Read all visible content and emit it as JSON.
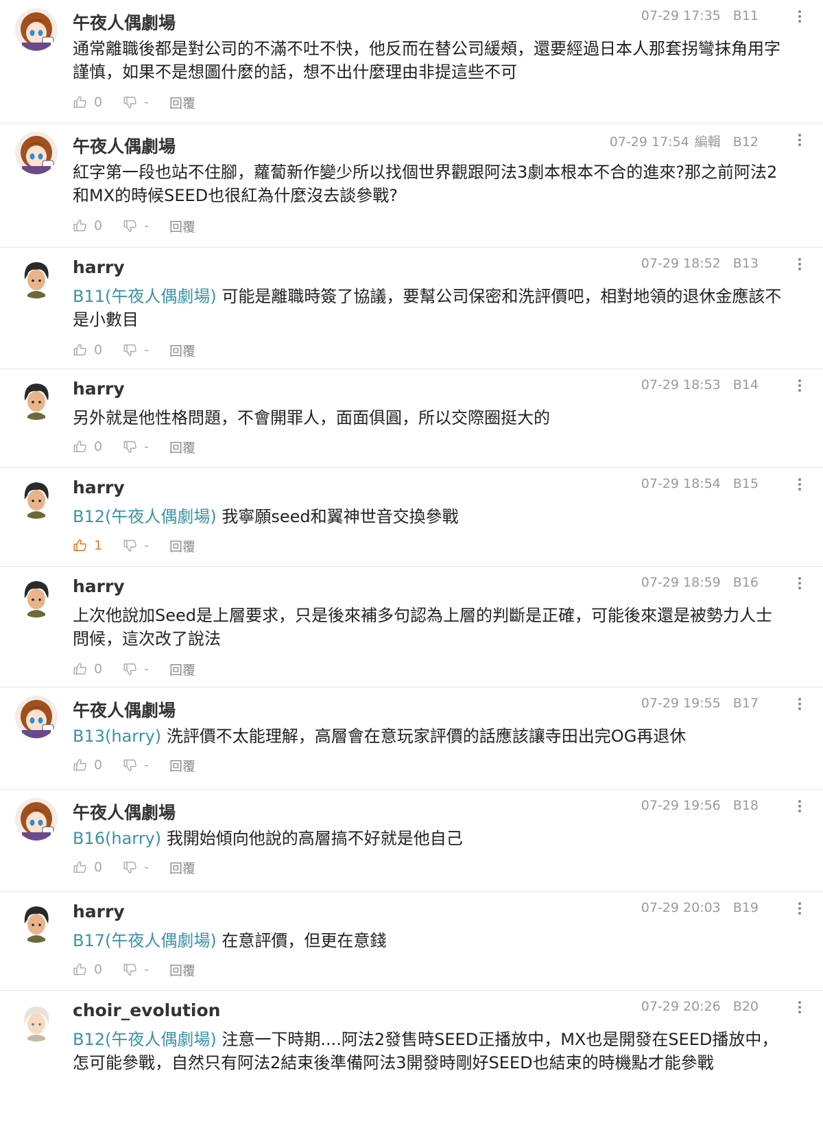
{
  "comments": [
    {
      "author": "午夜人偶劇場",
      "avatar": "anime-girl-avatar",
      "time": "07-29 17:35",
      "edited": "",
      "floor": "B11",
      "mention": "",
      "text": "通常離職後都是對公司的不滿不吐不快，他反而在替公司緩頰，還要經過日本人那套拐彎抹角用字謹慎，如果不是想圖什麼的話，想不出什麼理由非提這些不可",
      "likes": "0",
      "dislikes": "-",
      "reply_label": "回覆",
      "liked": false
    },
    {
      "author": "午夜人偶劇場",
      "avatar": "anime-girl-avatar",
      "time": "07-29 17:54",
      "edited": "編輯",
      "floor": "B12",
      "mention": "",
      "text": "紅字第一段也站不住腳，蘿蔔新作變少所以找個世界觀跟阿法3劇本根本不合的進來?那之前阿法2和MX的時候SEED也很紅為什麼沒去談參戰?",
      "likes": "0",
      "dislikes": "-",
      "reply_label": "回覆",
      "liked": false
    },
    {
      "author": "harry",
      "avatar": "dark-hair-boy-avatar",
      "time": "07-29 18:52",
      "edited": "",
      "floor": "B13",
      "mention": "B11(午夜人偶劇場)",
      "text": "可能是離職時簽了協議，要幫公司保密和洗評價吧，相對地領的退休金應該不是小數目",
      "likes": "0",
      "dislikes": "-",
      "reply_label": "回覆",
      "liked": false
    },
    {
      "author": "harry",
      "avatar": "dark-hair-boy-avatar",
      "time": "07-29 18:53",
      "edited": "",
      "floor": "B14",
      "mention": "",
      "text": "另外就是他性格問題，不會開罪人，面面俱圓，所以交際圈挺大的",
      "likes": "0",
      "dislikes": "-",
      "reply_label": "回覆",
      "liked": false
    },
    {
      "author": "harry",
      "avatar": "dark-hair-boy-avatar",
      "time": "07-29 18:54",
      "edited": "",
      "floor": "B15",
      "mention": "B12(午夜人偶劇場)",
      "text": "我寧願seed和翼神世音交換參戰",
      "likes": "1",
      "dislikes": "-",
      "reply_label": "回覆",
      "liked": true
    },
    {
      "author": "harry",
      "avatar": "dark-hair-boy-avatar",
      "time": "07-29 18:59",
      "edited": "",
      "floor": "B16",
      "mention": "",
      "text": "上次他說加Seed是上層要求，只是後來補多句認為上層的判斷是正確，可能後來還是被勢力人士問候，這次改了說法",
      "likes": "0",
      "dislikes": "-",
      "reply_label": "回覆",
      "liked": false
    },
    {
      "author": "午夜人偶劇場",
      "avatar": "anime-girl-avatar",
      "time": "07-29 19:55",
      "edited": "",
      "floor": "B17",
      "mention": "B13(harry)",
      "text": "洗評價不太能理解，高層會在意玩家評價的話應該讓寺田出完OG再退休",
      "likes": "0",
      "dislikes": "-",
      "reply_label": "回覆",
      "liked": false
    },
    {
      "author": "午夜人偶劇場",
      "avatar": "anime-girl-avatar",
      "time": "07-29 19:56",
      "edited": "",
      "floor": "B18",
      "mention": "B16(harry)",
      "text": "我開始傾向他說的高層搞不好就是他自己",
      "likes": "0",
      "dislikes": "-",
      "reply_label": "回覆",
      "liked": false
    },
    {
      "author": "harry",
      "avatar": "dark-hair-boy-avatar",
      "time": "07-29 20:03",
      "edited": "",
      "floor": "B19",
      "mention": "B17(午夜人偶劇場)",
      "text": "在意評價，但更在意錢",
      "likes": "0",
      "dislikes": "-",
      "reply_label": "回覆",
      "liked": false
    },
    {
      "author": "choir_evolution",
      "avatar": "white-hair-avatar",
      "time": "07-29 20:26",
      "edited": "",
      "floor": "B20",
      "mention": "B12(午夜人偶劇場)",
      "text": "注意一下時期....阿法2發售時SEED正播放中，MX也是開發在SEED播放中，怎可能參戰，自然只有阿法2結束後準備阿法3開發時剛好SEED也結束的時機點才能參戰",
      "likes": "",
      "dislikes": "",
      "reply_label": "",
      "liked": false
    }
  ],
  "colors": {
    "mention": "#3a93a5",
    "liked": "#e07a24",
    "meta": "#9a9a9a"
  }
}
